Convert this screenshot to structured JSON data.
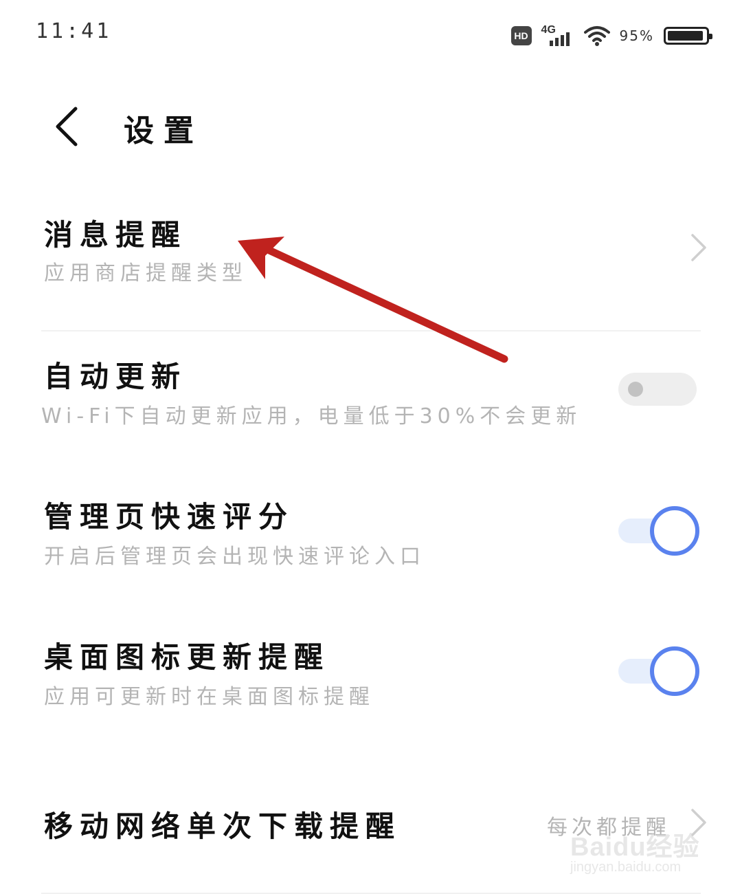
{
  "status_bar": {
    "time": "11:41",
    "hd_label": "HD",
    "network_label": "4G",
    "battery_percent": "95%",
    "battery_level": 0.95
  },
  "header": {
    "title": "设置"
  },
  "settings": [
    {
      "title": "消息提醒",
      "subtitle": "应用商店提醒类型",
      "control": "chevron"
    },
    {
      "title": "自动更新",
      "subtitle": "Wi-Fi下自动更新应用，电量低于30%不会更新",
      "control": "toggle",
      "enabled": false
    },
    {
      "title": "管理页快速评分",
      "subtitle": "开启后管理页会出现快速评论入口",
      "control": "toggle",
      "enabled": true
    },
    {
      "title": "桌面图标更新提醒",
      "subtitle": "应用可更新时在桌面图标提醒",
      "control": "toggle",
      "enabled": true
    },
    {
      "title": "移动网络单次下载提醒",
      "value": "每次都提醒",
      "control": "chevron"
    }
  ],
  "colors": {
    "accent": "#5a82ee",
    "annotation_arrow": "#c0221e",
    "subtitle_text": "#b4b4b4"
  },
  "watermark": {
    "main": "Baidu经验",
    "url": "jingyan.baidu.com"
  }
}
